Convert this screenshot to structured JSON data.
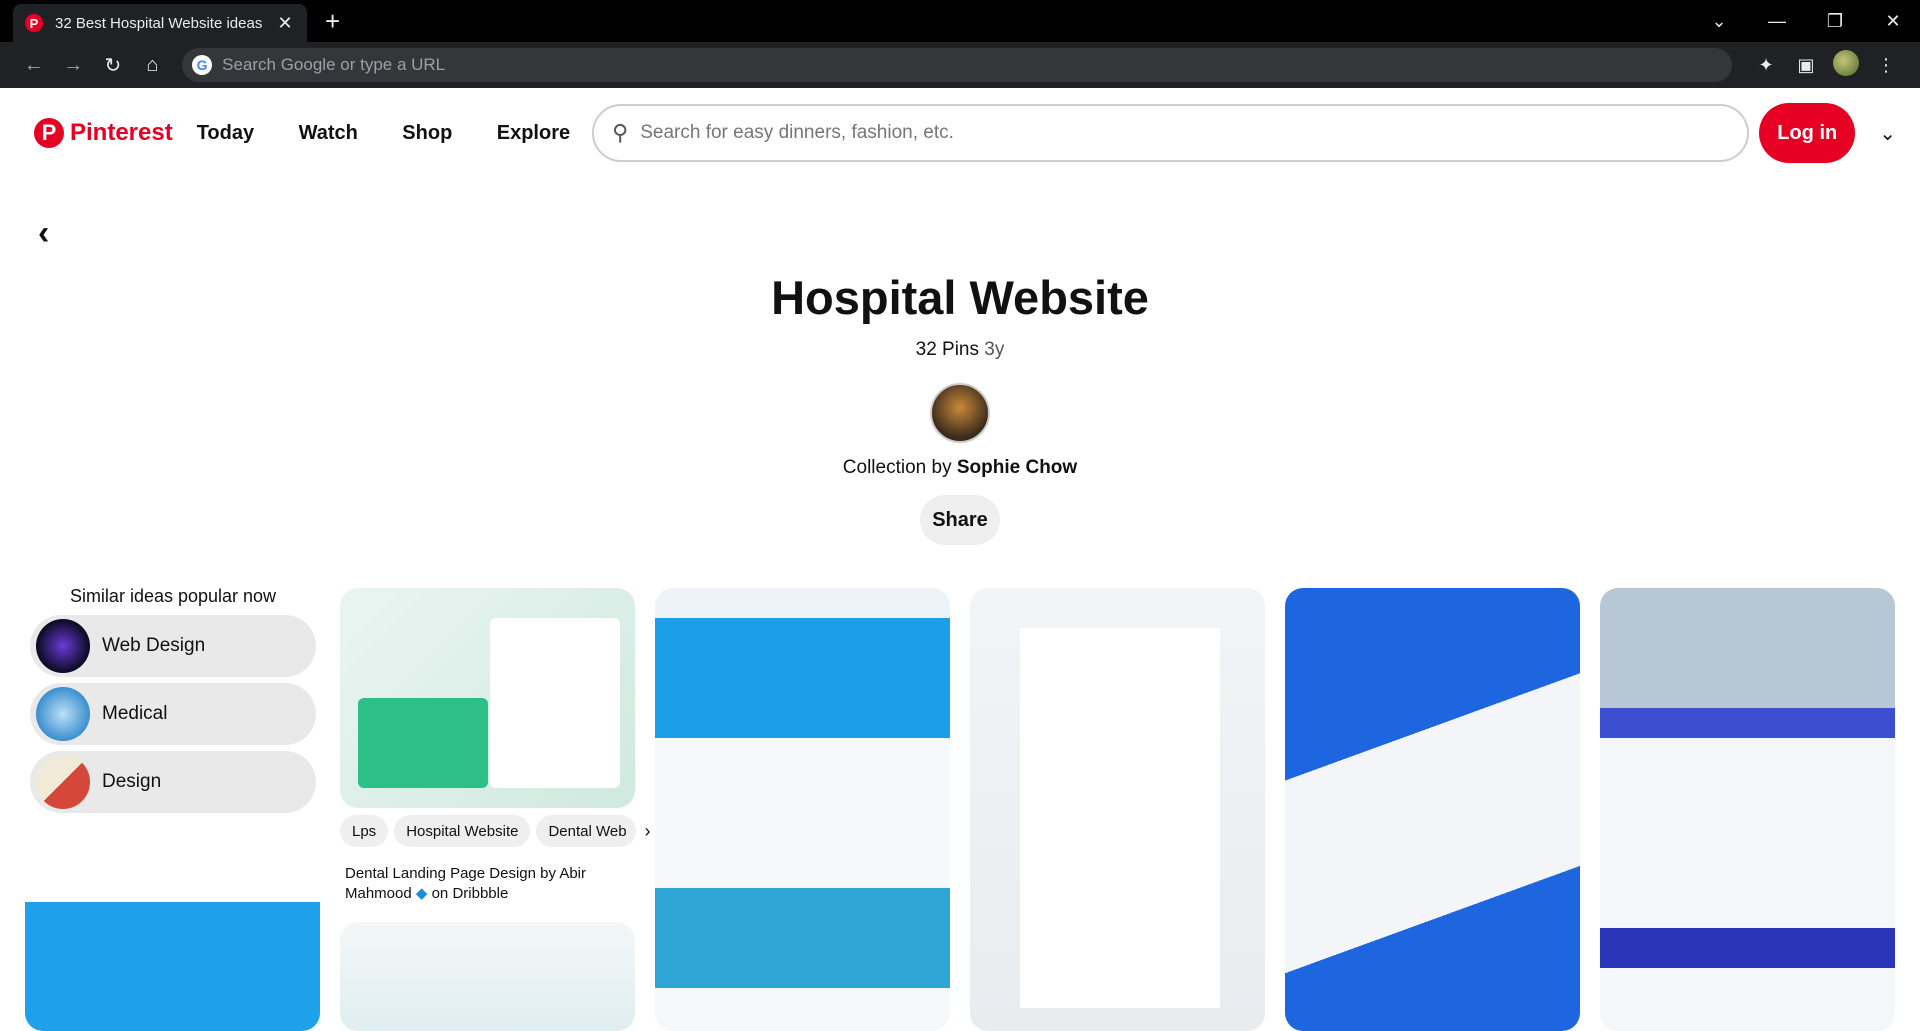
{
  "browser": {
    "tab_title": "32 Best Hospital Website ideas",
    "tab_close": "✕",
    "new_tab": "+",
    "omnibox_placeholder": "Search Google or type a URL"
  },
  "header": {
    "brand": "Pinterest",
    "nav": [
      "Today",
      "Watch",
      "Shop",
      "Explore"
    ],
    "search_placeholder": "Search for easy dinners, fashion, etc.",
    "login_label": "Log in"
  },
  "board": {
    "title": "Hospital Website",
    "pins_count": "32 Pins",
    "age": "3y",
    "collection_prefix": "Collection by",
    "owner": "Sophie Chow",
    "share_label": "Share"
  },
  "similar": {
    "heading": "Similar ideas popular now",
    "items": [
      "Web Design",
      "Medical",
      "Design"
    ]
  },
  "pin_tags": [
    "Lps",
    "Hospital Website",
    "Dental Web"
  ],
  "pin_caption": {
    "text": "Dental Landing Page Design by Abir Mahmood",
    "suffix": "on Dribbble"
  },
  "colors": {
    "brand": "#e60023",
    "chrome_dark": "#202124"
  }
}
